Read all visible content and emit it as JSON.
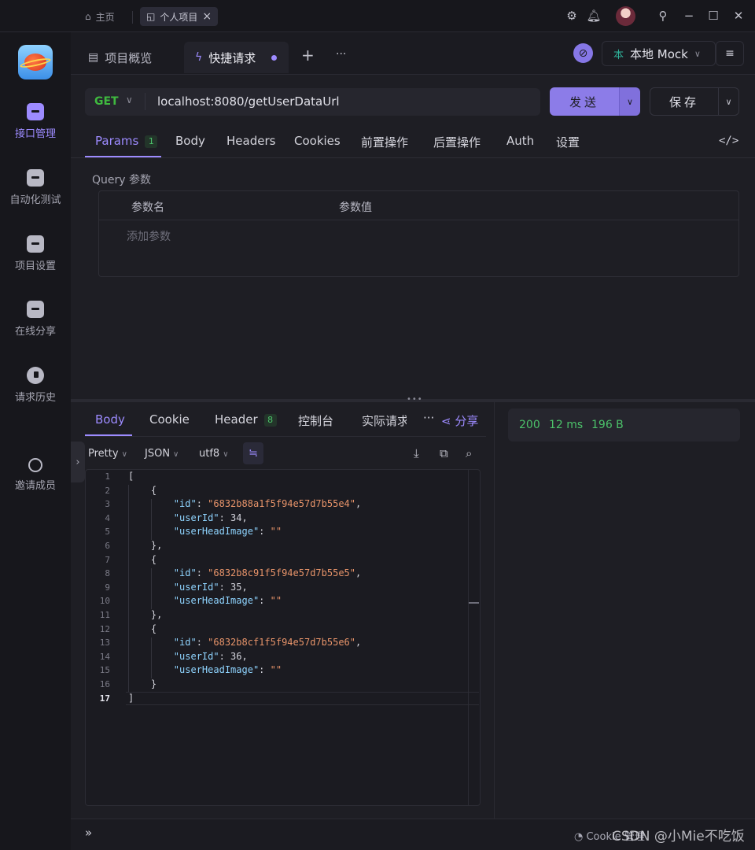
{
  "titlebar": {
    "home_label": "主页",
    "project_tab_label": "个人项目",
    "close_symbol": "×"
  },
  "sidebar": {
    "items": [
      {
        "label": "接口管理",
        "icon": "api-management-icon",
        "active": true
      },
      {
        "label": "自动化测试",
        "icon": "automation-test-icon",
        "active": false
      },
      {
        "label": "项目设置",
        "icon": "project-settings-icon",
        "active": false
      },
      {
        "label": "在线分享",
        "icon": "online-share-icon",
        "active": false
      },
      {
        "label": "请求历史",
        "icon": "request-history-icon",
        "active": false
      },
      {
        "label": "邀请成员",
        "icon": "invite-member-icon",
        "active": false
      }
    ]
  },
  "tabs": {
    "overview_label": "项目概览",
    "quick_request_label": "快捷请求",
    "add_symbol": "+",
    "more_symbol": "···"
  },
  "environment": {
    "badge": "本",
    "label": "本地 Mock"
  },
  "request": {
    "method": "GET",
    "url": "localhost:8080/getUserDataUrl",
    "send_label": "发送",
    "save_label": "保存"
  },
  "request_tabs": [
    {
      "label": "Params",
      "badge": "1",
      "active": true
    },
    {
      "label": "Body"
    },
    {
      "label": "Headers"
    },
    {
      "label": "Cookies"
    },
    {
      "label": "前置操作"
    },
    {
      "label": "后置操作"
    },
    {
      "label": "Auth"
    },
    {
      "label": "设置"
    }
  ],
  "params": {
    "section_label": "Query 参数",
    "col_name": "参数名",
    "col_value": "参数值",
    "add_placeholder": "添加参数"
  },
  "response_tabs": [
    {
      "label": "Body",
      "active": true
    },
    {
      "label": "Cookie"
    },
    {
      "label": "Header",
      "badge": "8"
    },
    {
      "label": "控制台"
    },
    {
      "label": "实际请求"
    }
  ],
  "response": {
    "share_label": "分享",
    "more_symbol": "···",
    "format": "Pretty",
    "language": "JSON",
    "encoding": "utf8",
    "status_code": "200",
    "time": "12 ms",
    "size": "196 B"
  },
  "code_lines": [
    {
      "n": "1",
      "text": "["
    },
    {
      "n": "2",
      "text": "    {"
    },
    {
      "n": "3",
      "key": "\"id\"",
      "value": "\"6832b88a1f5f94e57d7b55e4\"",
      "vtype": "s",
      "tail": ","
    },
    {
      "n": "4",
      "key": "\"userId\"",
      "value": "34",
      "vtype": "n",
      "tail": ","
    },
    {
      "n": "5",
      "key": "\"userHeadImage\"",
      "value": "\"\"",
      "vtype": "s",
      "tail": ""
    },
    {
      "n": "6",
      "text": "    },"
    },
    {
      "n": "7",
      "text": "    {"
    },
    {
      "n": "8",
      "key": "\"id\"",
      "value": "\"6832b8c91f5f94e57d7b55e5\"",
      "vtype": "s",
      "tail": ","
    },
    {
      "n": "9",
      "key": "\"userId\"",
      "value": "35",
      "vtype": "n",
      "tail": ","
    },
    {
      "n": "10",
      "key": "\"userHeadImage\"",
      "value": "\"\"",
      "vtype": "s",
      "tail": ""
    },
    {
      "n": "11",
      "text": "    },"
    },
    {
      "n": "12",
      "text": "    {"
    },
    {
      "n": "13",
      "key": "\"id\"",
      "value": "\"6832b8cf1f5f94e57d7b55e6\"",
      "vtype": "s",
      "tail": ","
    },
    {
      "n": "14",
      "key": "\"userId\"",
      "value": "36",
      "vtype": "n",
      "tail": ","
    },
    {
      "n": "15",
      "key": "\"userHeadImage\"",
      "value": "\"\"",
      "vtype": "s",
      "tail": ""
    },
    {
      "n": "16",
      "text": "    }"
    },
    {
      "n": "17",
      "text": "]",
      "current": true
    }
  ],
  "footer": {
    "expand_symbol": "»",
    "cookie_label": "Cookie 管理",
    "watermark": "CSDN @小Mie不吃饭"
  },
  "colors": {
    "accent": "#9d8bff",
    "success": "#4cc26a",
    "string": "#e8946a",
    "key": "#8fd4ff"
  }
}
